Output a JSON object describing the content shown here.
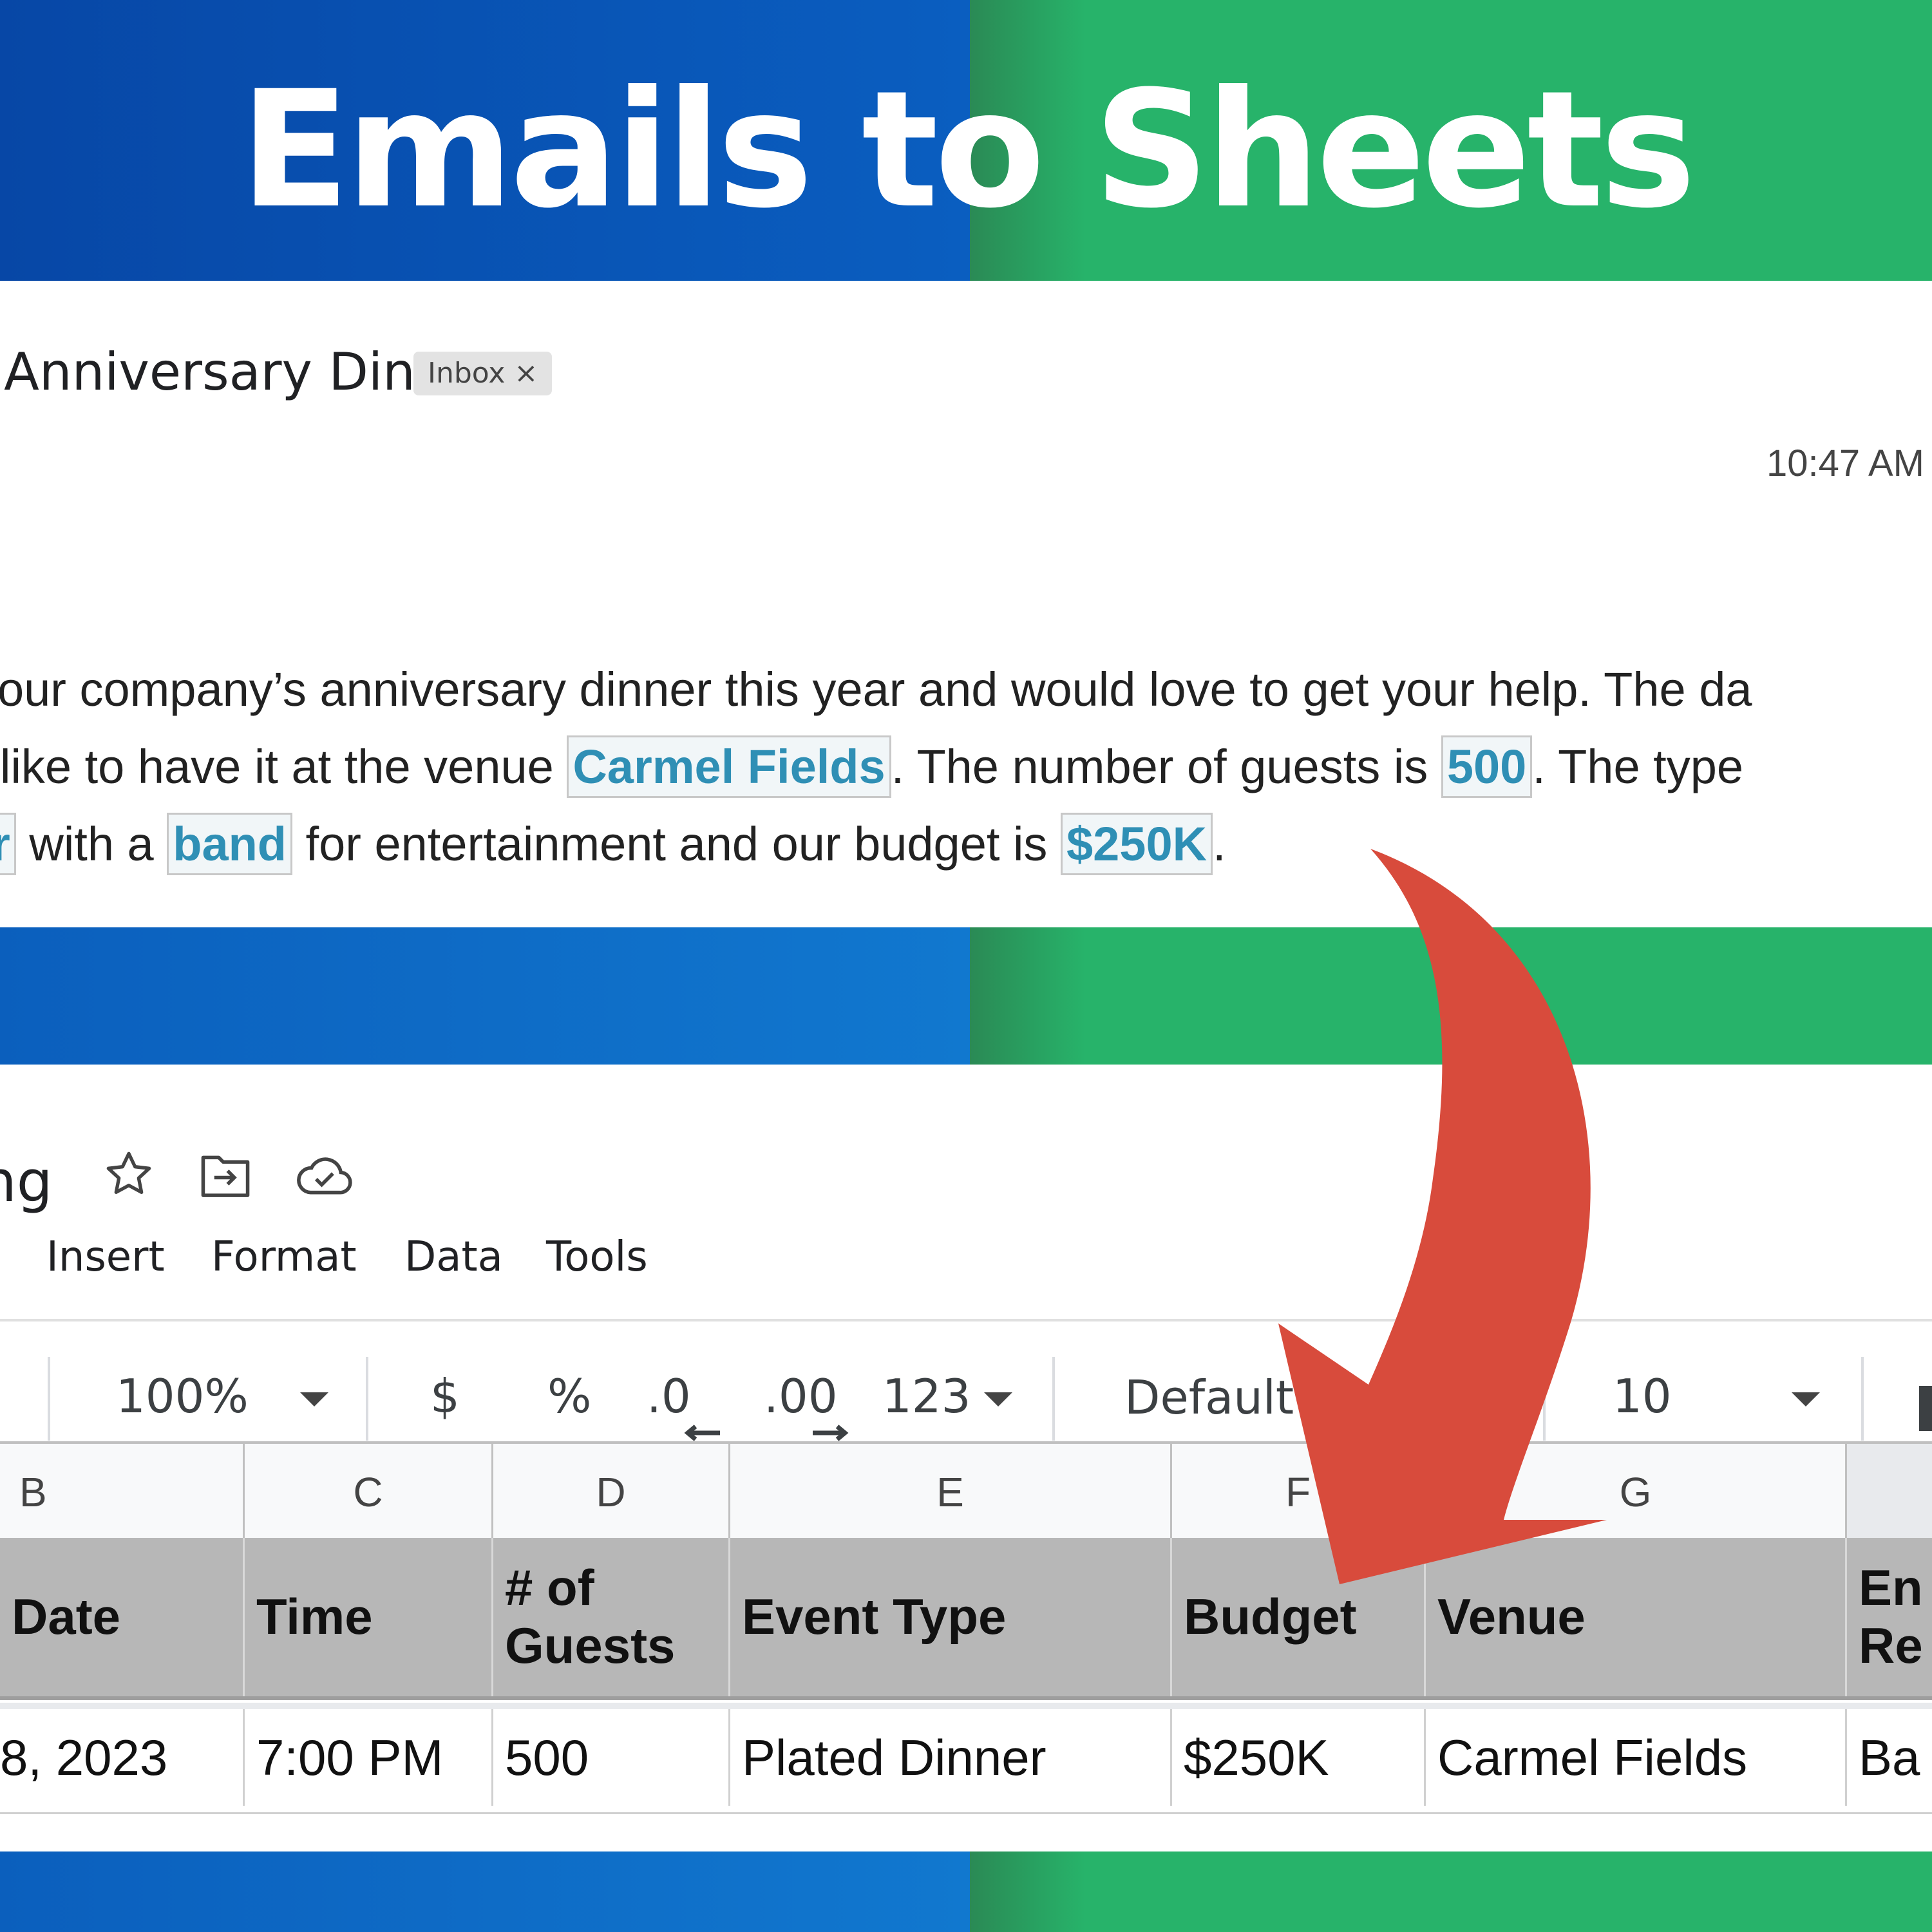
{
  "banner": {
    "title": "Emails to Sheets"
  },
  "email": {
    "subject": "Anniversary Dinner",
    "label_chip": "Inbox",
    "label_chip_close": "×",
    "time": "10:47 AM",
    "body": {
      "line1": "our company’s anniversary dinner this year and would love to get your help. The da",
      "line2_pre": " like to have it at the venue ",
      "venue": "Carmel Fields",
      "line2_mid": ". The number of guests is ",
      "guests": "500",
      "line2_post": ". The type",
      "line3_partial": "r",
      "line3_a": " with a ",
      "entertainment": "band",
      "line3_b": " for entertainment and our budget is ",
      "budget": "$250K",
      "line3_end": "."
    }
  },
  "sheet": {
    "doc_title_partial": "ng",
    "icons": [
      "star-icon",
      "move-folder-icon",
      "cloud-saved-icon"
    ],
    "menu": [
      "Insert",
      "Format",
      "Data",
      "Tools"
    ],
    "toolbar": {
      "zoom": "100%",
      "currency": "$",
      "percent": "%",
      "decrease_decimal": ".0",
      "increase_decimal": ".00",
      "number_format": "123",
      "font": "Default",
      "font_size": "10"
    },
    "columns": [
      "B",
      "C",
      "D",
      "E",
      "F",
      "G"
    ],
    "header_row": [
      "Date",
      "Time",
      "# of\nGuests",
      "Event Type",
      "Budget",
      "Venue",
      "En\nRe"
    ],
    "data_row": [
      "8, 2023",
      "7:00 PM",
      "500",
      "Plated Dinner",
      "$250K",
      "Carmel Fields",
      "Ba"
    ]
  },
  "colors": {
    "blue": "#0a5ec0",
    "green": "#27b36a",
    "arrow": "#d84b3c",
    "highlight_text": "#2f8fb5"
  }
}
